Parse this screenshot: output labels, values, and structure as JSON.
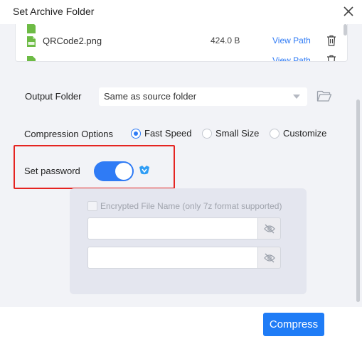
{
  "dialog": {
    "title": "Set Archive Folder",
    "close_icon": "close-icon"
  },
  "file_list": {
    "rows": [
      {
        "name": "QRCode2.png",
        "size": "424.0 B",
        "action": "View Path",
        "icon": "png-file-icon"
      },
      {
        "name": "...",
        "size": "",
        "action": "View Path",
        "icon": "png-file-icon"
      }
    ],
    "delete_icon": "trash-icon"
  },
  "output_folder": {
    "label": "Output Folder",
    "value": "Same as source folder",
    "browse_icon": "folder-icon"
  },
  "compression": {
    "label": "Compression Options",
    "options": [
      {
        "label": "Fast Speed",
        "checked": true
      },
      {
        "label": "Small Size",
        "checked": false
      },
      {
        "label": "Customize",
        "checked": false
      }
    ]
  },
  "password": {
    "label": "Set password",
    "enabled": true,
    "premium_icon": "vip-crown-icon",
    "encrypt_filename_label": "Encrypted File Name (only 7z format supported)",
    "encrypt_filename_checked": false,
    "fields": [
      {
        "value": "",
        "icon": "eye-off-icon"
      },
      {
        "value": "",
        "icon": "eye-off-icon"
      }
    ]
  },
  "footer": {
    "compress_label": "Compress"
  },
  "colors": {
    "accent": "#2f7bf5",
    "button": "#1f7cf6",
    "highlight": "#e52421",
    "panel_bg": "#f2f3f7"
  }
}
